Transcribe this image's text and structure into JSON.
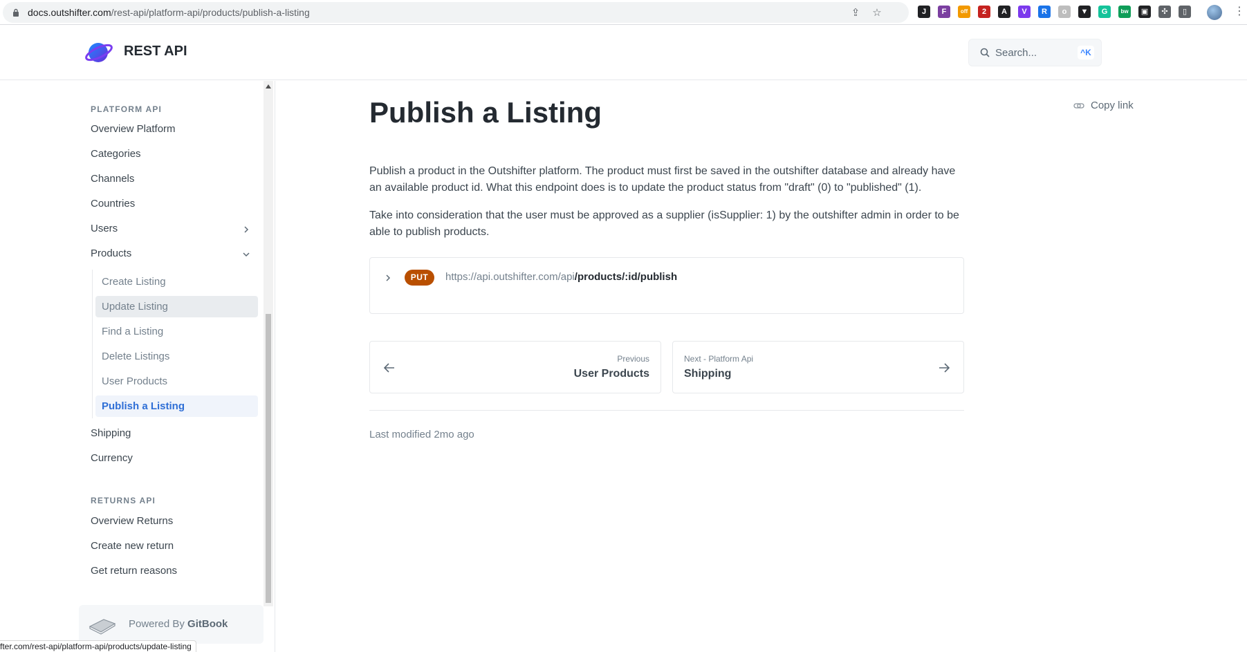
{
  "browser": {
    "url_domain": "docs.outshifter.com",
    "url_path": "/rest-api/platform-api/products/publish-a-listing",
    "status_url": "fter.com/rest-api/platform-api/products/update-listing",
    "extensions": [
      {
        "name": "ext-1",
        "color": "#202124",
        "label": "J"
      },
      {
        "name": "ext-2",
        "color": "#7b3fa0",
        "label": "F"
      },
      {
        "name": "ext-3",
        "color": "#f29900",
        "label": "off"
      },
      {
        "name": "ext-4",
        "color": "#c5221f",
        "label": "2"
      },
      {
        "name": "ext-5",
        "color": "#202124",
        "label": "A"
      },
      {
        "name": "ext-6",
        "color": "#7c3aed",
        "label": "V"
      },
      {
        "name": "ext-7",
        "color": "#1a73e8",
        "label": "R"
      },
      {
        "name": "ext-8",
        "color": "#bdbdbd",
        "label": "o"
      },
      {
        "name": "ext-9",
        "color": "#202124",
        "label": "▼"
      },
      {
        "name": "ext-10",
        "color": "#15c39a",
        "label": "G"
      },
      {
        "name": "ext-11",
        "color": "#0f9d58",
        "label": "bw"
      },
      {
        "name": "ext-12",
        "color": "#202124",
        "label": "▣"
      },
      {
        "name": "ext-13",
        "color": "#5f6368",
        "label": "✣"
      },
      {
        "name": "ext-14",
        "color": "#5f6368",
        "label": "▯"
      }
    ]
  },
  "header": {
    "brand": "REST API",
    "search_placeholder": "Search...",
    "search_shortcut": "^K"
  },
  "sidebar": {
    "platform_title": "PLATFORM API",
    "platform_items": [
      "Overview Platform",
      "Categories",
      "Channels",
      "Countries",
      "Users",
      "Products"
    ],
    "products_sub": [
      "Create Listing",
      "Update Listing",
      "Find a Listing",
      "Delete Listings",
      "User Products",
      "Publish a Listing"
    ],
    "after_items": [
      "Shipping",
      "Currency"
    ],
    "returns_title": "RETURNS API",
    "returns_items": [
      "Overview Returns",
      "Create new return",
      "Get return reasons"
    ],
    "powered_by": "Powered By",
    "powered_brand": "GitBook"
  },
  "main": {
    "title": "Publish a Listing",
    "copy_link": "Copy link",
    "para1": "Publish a product in the Outshifter platform. The product must first be saved in the outshifter database and already have an available product id. What this endpoint does is to update the product status from \"draft\" (0) to \"published\" (1).",
    "para2": "Take into consideration that the user must be approved as a supplier (isSupplier: 1) by the outshifter admin in order to be able to publish products.",
    "api": {
      "method": "PUT",
      "base_url": "https://api.outshifter.com/api",
      "path": "/products/:id/publish"
    },
    "prev": {
      "small": "Previous",
      "big": "User Products"
    },
    "next": {
      "small": "Next - Platform Api",
      "big": "Shipping"
    },
    "last_modified": "Last modified 2mo ago"
  },
  "colors": {
    "accent": "#3884ff",
    "put_badge": "#b94f00"
  }
}
